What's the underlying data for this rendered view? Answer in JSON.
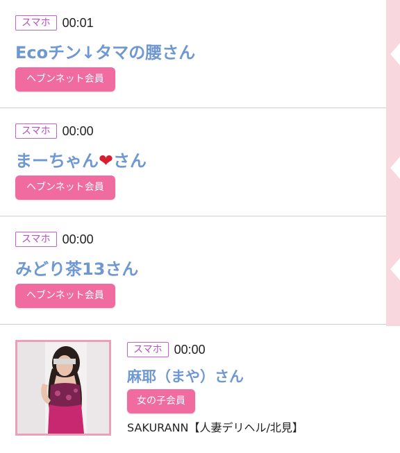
{
  "posts": [
    {
      "device": "スマホ",
      "time": "00:01",
      "name": "Ecoチン↓タマの腰さん",
      "badge": "ヘブンネット会員"
    },
    {
      "device": "スマホ",
      "time": "00:00",
      "name_before": "まーちゃん",
      "name_emoji": "❤",
      "name_after": "さん",
      "badge": "ヘブンネット会員"
    },
    {
      "device": "スマホ",
      "time": "00:00",
      "name": "みどり茶13さん",
      "badge": "ヘブンネット会員"
    }
  ],
  "last_post": {
    "device": "スマホ",
    "time": "00:00",
    "name": "麻耶（まや）さん",
    "badge": "女の子会員",
    "shop": "SAKURANN【人妻デリヘル/北見】"
  },
  "colors": {
    "name_blue": "#6f98d2",
    "badge_pink": "#ef6ba0",
    "device_purple": "#c85fcf",
    "divider": "#cfcfcf",
    "side_band": "#f8d8de"
  }
}
